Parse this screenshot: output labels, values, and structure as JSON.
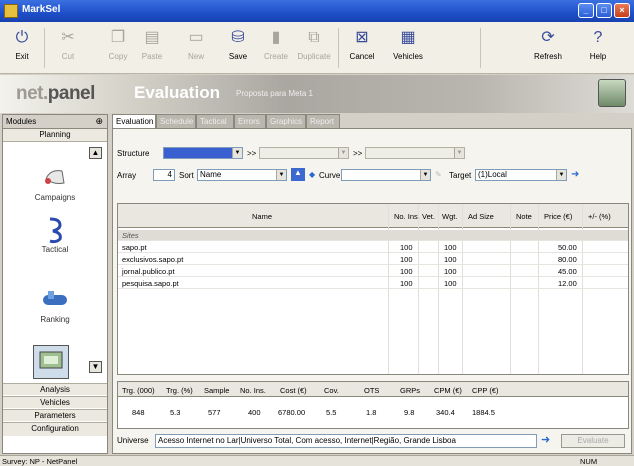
{
  "window": {
    "title": "MarkSel"
  },
  "toolbar": {
    "buttons": [
      {
        "label": "Exit",
        "icon": "exit-icon",
        "glyph": "⏻",
        "enabled": true
      },
      {
        "label": "Cut",
        "icon": "scissors-icon",
        "glyph": "✂",
        "enabled": false
      },
      {
        "label": "Copy",
        "icon": "copy-icon",
        "glyph": "❐",
        "enabled": false
      },
      {
        "label": "Paste",
        "icon": "paste-icon",
        "glyph": "▤",
        "enabled": false
      },
      {
        "label": "New",
        "icon": "new-icon",
        "glyph": "▭",
        "enabled": false
      },
      {
        "label": "Save",
        "icon": "save-icon",
        "glyph": "⛁",
        "enabled": true
      },
      {
        "label": "Create",
        "icon": "create-icon",
        "glyph": "▮",
        "enabled": false
      },
      {
        "label": "Duplicate",
        "icon": "duplicate-icon",
        "glyph": "⧉",
        "enabled": false
      },
      {
        "label": "Cancel",
        "icon": "cancel-icon",
        "glyph": "⊠",
        "enabled": true
      },
      {
        "label": "Vehicles",
        "icon": "vehicles-icon",
        "glyph": "▦",
        "enabled": true
      },
      {
        "label": "Refresh",
        "icon": "refresh-icon",
        "glyph": "⟳",
        "enabled": true
      },
      {
        "label": "Help",
        "icon": "help-icon",
        "glyph": "?",
        "enabled": true
      }
    ]
  },
  "banner": {
    "logo_a": "net.",
    "logo_b": "panel",
    "title": "Evaluation",
    "subtitle": "Proposta para Meta 1"
  },
  "sidebar": {
    "header": "Modules",
    "group": "Planning",
    "items": [
      {
        "label": "Campaigns",
        "icon": "campaigns-icon"
      },
      {
        "label": "Tactical",
        "icon": "tactical-icon"
      },
      {
        "label": "Ranking",
        "icon": "ranking-icon"
      }
    ],
    "bottom": [
      "Analysis",
      "Vehicles",
      "Parameters",
      "Configuration"
    ]
  },
  "tabs": [
    "Evaluation",
    "Schedule",
    "Tactical",
    "Errors",
    "Graphics",
    "Report"
  ],
  "controls": {
    "structure_label": "Structure",
    "arrow_a": ">>",
    "arrow_b": ">>",
    "array_label": "Array",
    "array_value": "4",
    "sort_label": "Sort",
    "sort_value": "Name",
    "curve_label": "Curve",
    "target_label": "Target",
    "target_value": "(1)Local"
  },
  "grid": {
    "columns": [
      "Name",
      "No. Ins.",
      "Vet.",
      "Wgt.",
      "Ad Size",
      "Note",
      "Price (€)",
      "+/- (%)"
    ],
    "group": "Sites",
    "rows": [
      {
        "name": "sapo.pt",
        "ins": "100",
        "wgt": "100",
        "price": "50.00"
      },
      {
        "name": "exclusivos.sapo.pt",
        "ins": "100",
        "wgt": "100",
        "price": "80.00"
      },
      {
        "name": "jornal.publico.pt",
        "ins": "100",
        "wgt": "100",
        "price": "45.00"
      },
      {
        "name": "pesquisa.sapo.pt",
        "ins": "100",
        "wgt": "100",
        "price": "12.00"
      }
    ]
  },
  "results": {
    "headers": [
      "Trg. (000)",
      "Trg. (%)",
      "Sample",
      "No. Ins.",
      "Cost (€)",
      "Cov.",
      "OTS",
      "GRPs",
      "CPM (€)",
      "CPP (€)"
    ],
    "values": [
      "848",
      "5.3",
      "577",
      "400",
      "6780.00",
      "5.5",
      "1.8",
      "9.8",
      "340.4",
      "1884.5"
    ]
  },
  "universe": {
    "label": "Universe",
    "value": "Acesso Internet no Lar|Universo Total, Com acesso, Internet|Região, Grande Lisboa",
    "evaluate_label": "Evaluate"
  },
  "status": {
    "left": "Survey: NP - NetPanel",
    "right": "NUM"
  }
}
